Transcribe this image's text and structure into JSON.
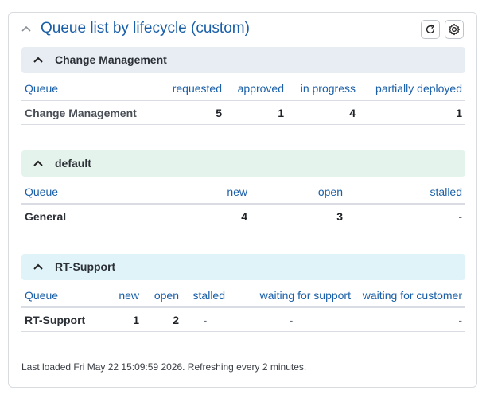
{
  "widget": {
    "title": "Queue list by lifecycle (custom)",
    "refresh_icon": "refresh-icon",
    "settings_icon": "gear-icon",
    "accent_color": "#1a5fa8"
  },
  "sections": [
    {
      "title": "Change Management",
      "header_color": "#e8ecf3",
      "columns": [
        "Queue",
        "requested",
        "approved",
        "in progress",
        "partially deployed"
      ],
      "rows": [
        {
          "queue": "Change Management",
          "values": [
            "5",
            "1",
            "4",
            "1"
          ]
        }
      ]
    },
    {
      "title": "default",
      "header_color": "#e4f3ec",
      "columns": [
        "Queue",
        "new",
        "open",
        "stalled"
      ],
      "rows": [
        {
          "queue": "General",
          "values": [
            "4",
            "3",
            "-"
          ]
        }
      ]
    },
    {
      "title": "RT-Support",
      "header_color": "#dff3f8",
      "columns": [
        "Queue",
        "new",
        "open",
        "stalled",
        "waiting for support",
        "waiting for customer"
      ],
      "rows": [
        {
          "queue": "RT-Support",
          "values": [
            "1",
            "2",
            "-",
            "-",
            "-"
          ]
        }
      ]
    }
  ],
  "footer": {
    "text": "Last loaded Fri May 22 15:09:59 2026. Refreshing every 2 minutes."
  }
}
